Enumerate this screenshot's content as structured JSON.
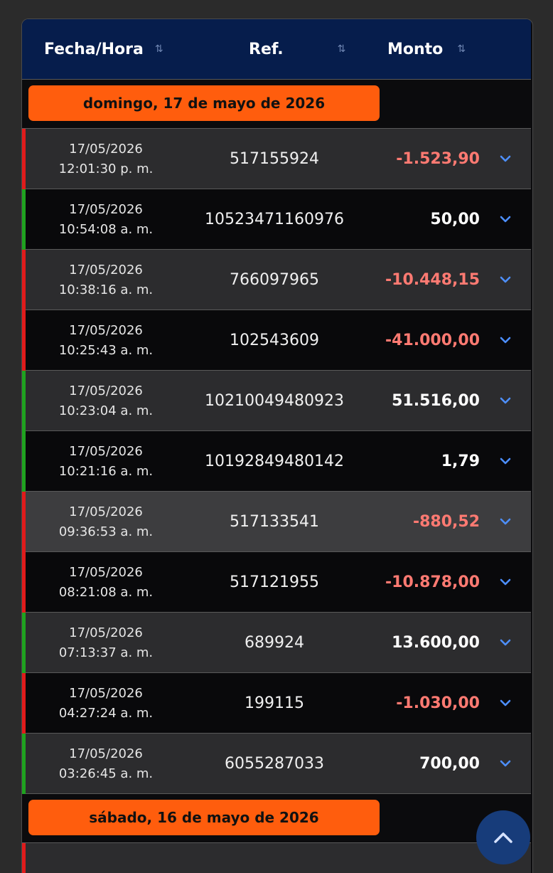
{
  "header": {
    "columns": [
      {
        "label": "Fecha/Hora",
        "sort_icon": "⇅"
      },
      {
        "label": "Ref.",
        "sort_icon": "⇅"
      },
      {
        "label": "Monto",
        "sort_icon": "⇅"
      }
    ]
  },
  "groups": [
    {
      "date_label": "domingo, 17 de mayo de 2026"
    },
    {
      "date_label": "sábado, 16 de mayo de 2026"
    }
  ],
  "transactions": [
    {
      "date": "17/05/2026",
      "time": "12:01:30 p. m.",
      "ref": "517155924",
      "amount": "-1.523,90",
      "sign": "negative"
    },
    {
      "date": "17/05/2026",
      "time": "10:54:08 a. m.",
      "ref": "10523471160976",
      "amount": "50,00",
      "sign": "positive"
    },
    {
      "date": "17/05/2026",
      "time": "10:38:16 a. m.",
      "ref": "766097965",
      "amount": "-10.448,15",
      "sign": "negative"
    },
    {
      "date": "17/05/2026",
      "time": "10:25:43 a. m.",
      "ref": "102543609",
      "amount": "-41.000,00",
      "sign": "negative"
    },
    {
      "date": "17/05/2026",
      "time": "10:23:04 a. m.",
      "ref": "10210049480923",
      "amount": "51.516,00",
      "sign": "positive"
    },
    {
      "date": "17/05/2026",
      "time": "10:21:16 a. m.",
      "ref": "10192849480142",
      "amount": "1,79",
      "sign": "positive"
    },
    {
      "date": "17/05/2026",
      "time": "09:36:53 a. m.",
      "ref": "517133541",
      "amount": "-880,52",
      "sign": "negative"
    },
    {
      "date": "17/05/2026",
      "time": "08:21:08 a. m.",
      "ref": "517121955",
      "amount": "-10.878,00",
      "sign": "negative"
    },
    {
      "date": "17/05/2026",
      "time": "07:13:37 a. m.",
      "ref": "689924",
      "amount": "13.600,00",
      "sign": "positive"
    },
    {
      "date": "17/05/2026",
      "time": "04:27:24 a. m.",
      "ref": "199115",
      "amount": "-1.030,00",
      "sign": "negative"
    },
    {
      "date": "17/05/2026",
      "time": "03:26:45 a. m.",
      "ref": "6055287033",
      "amount": "700,00",
      "sign": "positive"
    }
  ],
  "colors": {
    "header_bg": "#061d4c",
    "date_pill": "#ff5d0d",
    "negative_amount": "#ff7a72",
    "negative_bar": "#e01b1b",
    "positive_bar": "#1fa21f",
    "chevron": "#4d8fff",
    "scroll_top_button": "#173c7a"
  },
  "icons": {
    "row_expand": "chevron-down-icon",
    "scroll_top": "chevron-up-icon"
  }
}
